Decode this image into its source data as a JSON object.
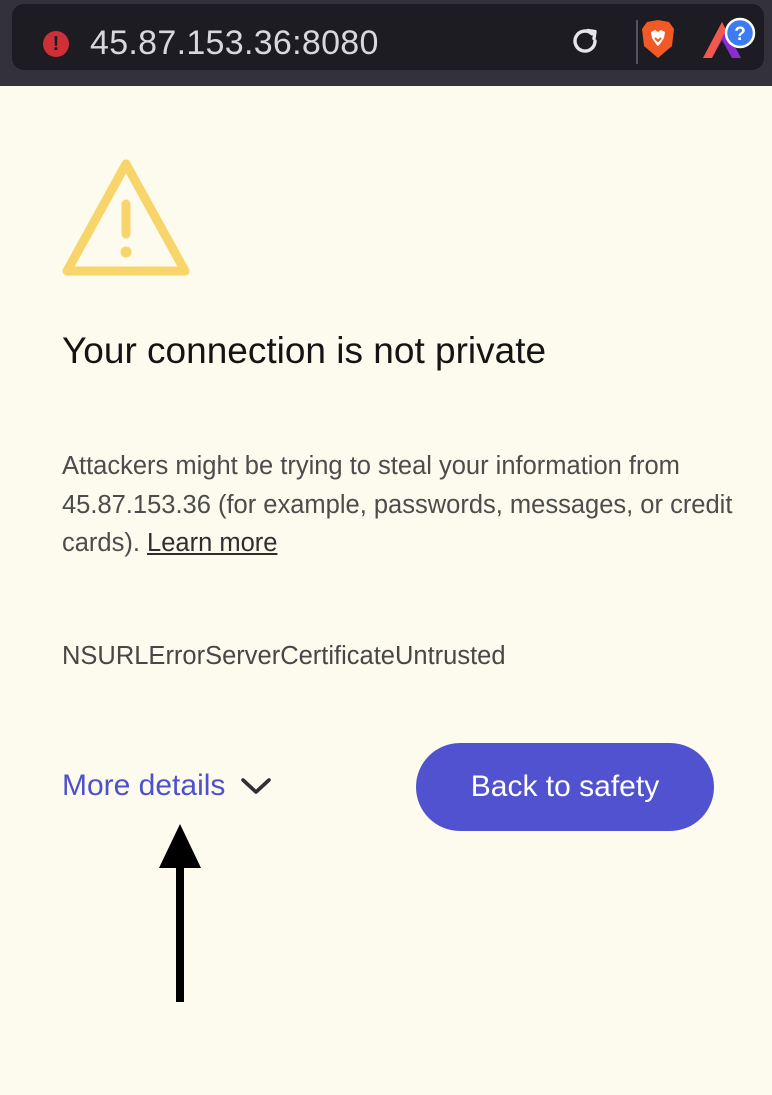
{
  "browser": {
    "address_bar": {
      "security_icon": "not-secure-warning-icon",
      "url": "45.87.153.36:8080",
      "reload_icon": "reload-icon"
    },
    "extensions": [
      "brave-shields-icon",
      "brave-rewards-icon"
    ],
    "rewards_badge": "?"
  },
  "interstitial": {
    "warning_icon": "warning-triangle-icon",
    "title": "Your connection is not private",
    "description": "Attackers might be trying to steal your information from 45.87.153.36 (for example, passwords, messages, or credit cards).",
    "learn_more_link": "Learn more",
    "error_code": "NSURLErrorServerCertificateUntrusted",
    "more_details_label": "More details",
    "more_details_icon": "chevron-down-icon",
    "back_button_label": "Back to safety"
  },
  "annotation": {
    "arrow_icon": "up-arrow-annotation-icon"
  },
  "colors": {
    "page_background": "#fdfaee",
    "toolbar": "#33323a",
    "urlbar": "#1d1c22",
    "warning_yellow": "#f7d56a",
    "accent_blue": "#5152d0",
    "link_blue": "#4d52cc",
    "not_secure_red": "#cf2f37"
  }
}
